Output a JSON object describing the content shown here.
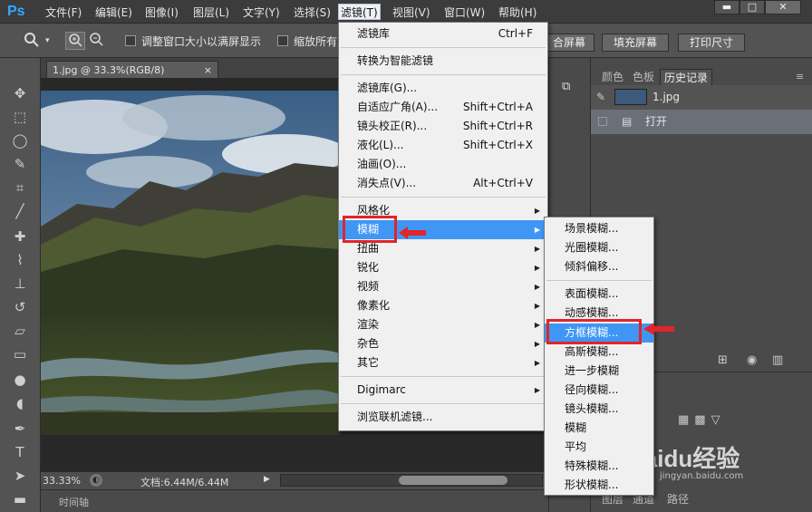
{
  "app": {
    "logo": "Ps"
  },
  "menubar": {
    "items": [
      "文件(F)",
      "编辑(E)",
      "图像(I)",
      "图层(L)",
      "文字(Y)",
      "选择(S)",
      "滤镜(T)",
      "视图(V)",
      "窗口(W)",
      "帮助(H)"
    ],
    "active": "滤镜(T)"
  },
  "window_controls": {
    "minimize": "▬",
    "maximize": "□",
    "close": "✕"
  },
  "options": {
    "zoom_icon": "🔍",
    "resize_windows_label": "调整窗口大小以满屏显示",
    "zoom_all_label": "缩放所有",
    "fill_label": "合屏幕",
    "fill_screen": "填充屏幕",
    "print_size": "打印尺寸"
  },
  "document": {
    "tab": "1.jpg @ 33.3%(RGB/8)",
    "close": "×",
    "zoom": "33.33%",
    "doc_info": "文档:6.44M/6.44M"
  },
  "timeline": {
    "label": "时间轴"
  },
  "filter_menu": {
    "items": [
      {
        "label": "滤镜库",
        "shortcut": "Ctrl+F"
      },
      {
        "label": "转换为智能滤镜",
        "shortcut": ""
      },
      {
        "label": "滤镜库(G)...",
        "shortcut": ""
      },
      {
        "label": "自适应广角(A)...",
        "shortcut": "Shift+Ctrl+A"
      },
      {
        "label": "镜头校正(R)...",
        "shortcut": "Shift+Ctrl+R"
      },
      {
        "label": "液化(L)...",
        "shortcut": "Shift+Ctrl+X"
      },
      {
        "label": "油画(O)...",
        "shortcut": ""
      },
      {
        "label": "消失点(V)...",
        "shortcut": "Alt+Ctrl+V"
      },
      {
        "label": "风格化",
        "shortcut": ""
      },
      {
        "label": "模糊",
        "shortcut": ""
      },
      {
        "label": "扭曲",
        "shortcut": ""
      },
      {
        "label": "锐化",
        "shortcut": ""
      },
      {
        "label": "视频",
        "shortcut": ""
      },
      {
        "label": "像素化",
        "shortcut": ""
      },
      {
        "label": "渲染",
        "shortcut": ""
      },
      {
        "label": "杂色",
        "shortcut": ""
      },
      {
        "label": "其它",
        "shortcut": ""
      },
      {
        "label": "Digimarc",
        "shortcut": ""
      },
      {
        "label": "浏览联机滤镜...",
        "shortcut": ""
      }
    ]
  },
  "blur_submenu": {
    "items": [
      "场景模糊...",
      "光圈模糊...",
      "倾斜偏移...",
      "表面模糊...",
      "动感模糊...",
      "方框模糊...",
      "高斯模糊...",
      "进一步模糊",
      "径向模糊...",
      "镜头模糊...",
      "模糊",
      "平均",
      "特殊模糊...",
      "形状模糊..."
    ]
  },
  "right_panel": {
    "tabs": [
      "颜色",
      "色板",
      "历史记录"
    ],
    "history": [
      {
        "label": "1.jpg"
      },
      {
        "label": "打开"
      }
    ],
    "bottom_tabs": [
      "图层",
      "通道",
      "路径"
    ]
  },
  "watermark": {
    "text": "Baidu经验",
    "url": "jingyan.baidu.com"
  },
  "colors": {
    "highlight": "#3f96f5",
    "annotation_red": "#e0252b",
    "menu_bg": "#f0f0f0"
  }
}
